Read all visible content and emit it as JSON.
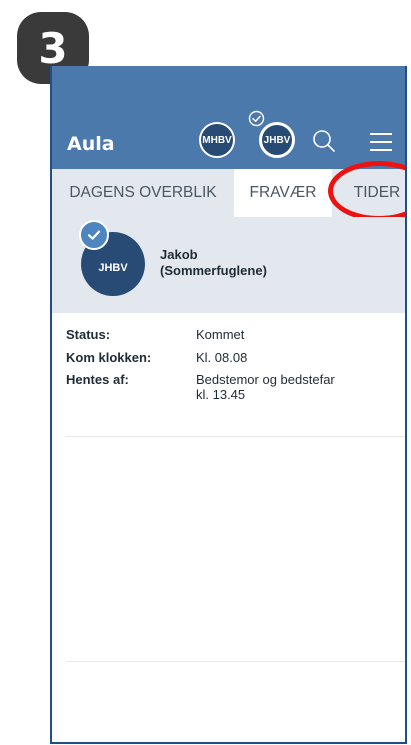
{
  "step_badge": "3",
  "app": {
    "title": "Aula"
  },
  "header": {
    "avatars": [
      {
        "initials": "MHBV",
        "selected": false
      },
      {
        "initials": "JHBV",
        "selected": true
      }
    ],
    "icons": [
      "check-icon",
      "search-icon",
      "menu-icon"
    ]
  },
  "tabs": [
    {
      "label": "DAGENS OVERBLIK",
      "active": false
    },
    {
      "label": "FRAVÆR",
      "active": true
    },
    {
      "label": "TIDER",
      "active": false,
      "highlighted": true
    }
  ],
  "child": {
    "initials": "JHBV",
    "name": "Jakob",
    "group": "(Sommerfuglene)",
    "checked_in": true
  },
  "details": [
    {
      "label": "Status:",
      "value": "Kommet",
      "value2": ""
    },
    {
      "label": "Kom klokken:",
      "value": "Kl. 08.08",
      "value2": ""
    },
    {
      "label": "Hentes af:",
      "value": "Bedstemor og bedstefar",
      "value2": "kl. 13.45"
    }
  ],
  "colors": {
    "header": "#4b79ac",
    "avatar": "#274b74",
    "tab_bar": "#e3e8ee",
    "highlight": "#ee1111",
    "check_badge": "#4f85bf"
  }
}
